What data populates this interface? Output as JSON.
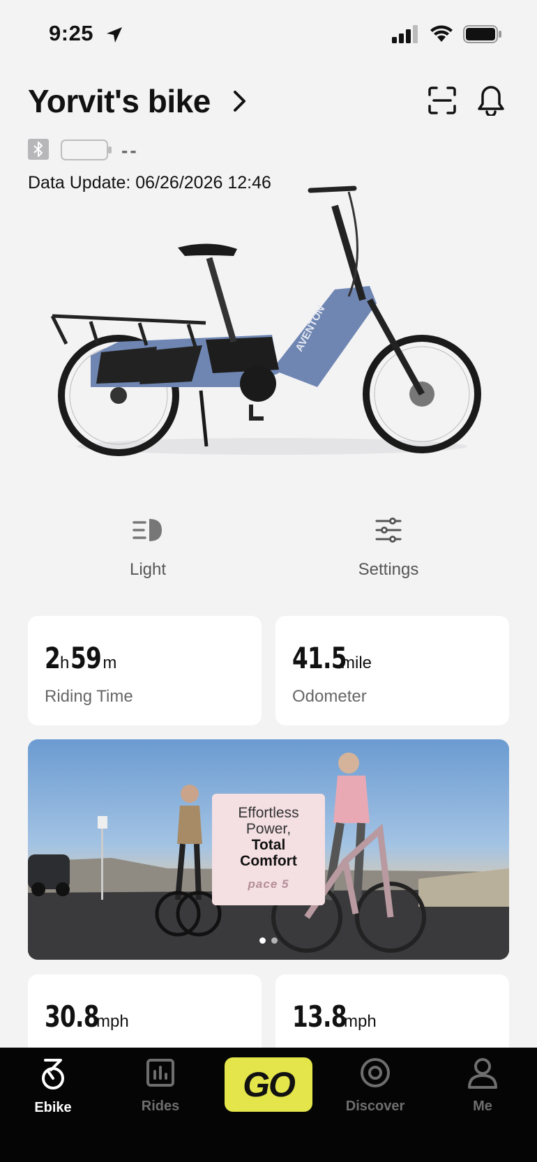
{
  "status_bar": {
    "time": "9:25"
  },
  "header": {
    "bike_name": "Yorvit's bike"
  },
  "connection": {
    "battery_text": "--",
    "data_update": "Data Update: 06/26/2026 12:46"
  },
  "actions": [
    {
      "label": "Light",
      "icon": "headlight-icon"
    },
    {
      "label": "Settings",
      "icon": "sliders-icon"
    }
  ],
  "stats": {
    "riding_time": {
      "hours": "2",
      "hours_unit": "h",
      "minutes": "59",
      "minutes_unit": "m",
      "caption": "Riding Time"
    },
    "odometer": {
      "value": "41.5",
      "unit": "mile",
      "caption": "Odometer"
    },
    "max_speed": {
      "value": "30.8",
      "unit": "mph"
    },
    "avg_speed": {
      "value": "13.8",
      "unit": "mph"
    }
  },
  "banner": {
    "line1": "Effortless",
    "line2": "Power,",
    "line3": "Total",
    "line4": "Comfort",
    "brand": "pace 5",
    "page_index": 0,
    "page_count": 2
  },
  "tabs": {
    "ebike": "Ebike",
    "rides": "Rides",
    "go": "GO",
    "discover": "Discover",
    "me": "Me",
    "active": "Ebike"
  },
  "colors": {
    "accent": "#e3e54a",
    "bike_frame": "#6f86b3",
    "tabbar_bg": "#050505"
  }
}
